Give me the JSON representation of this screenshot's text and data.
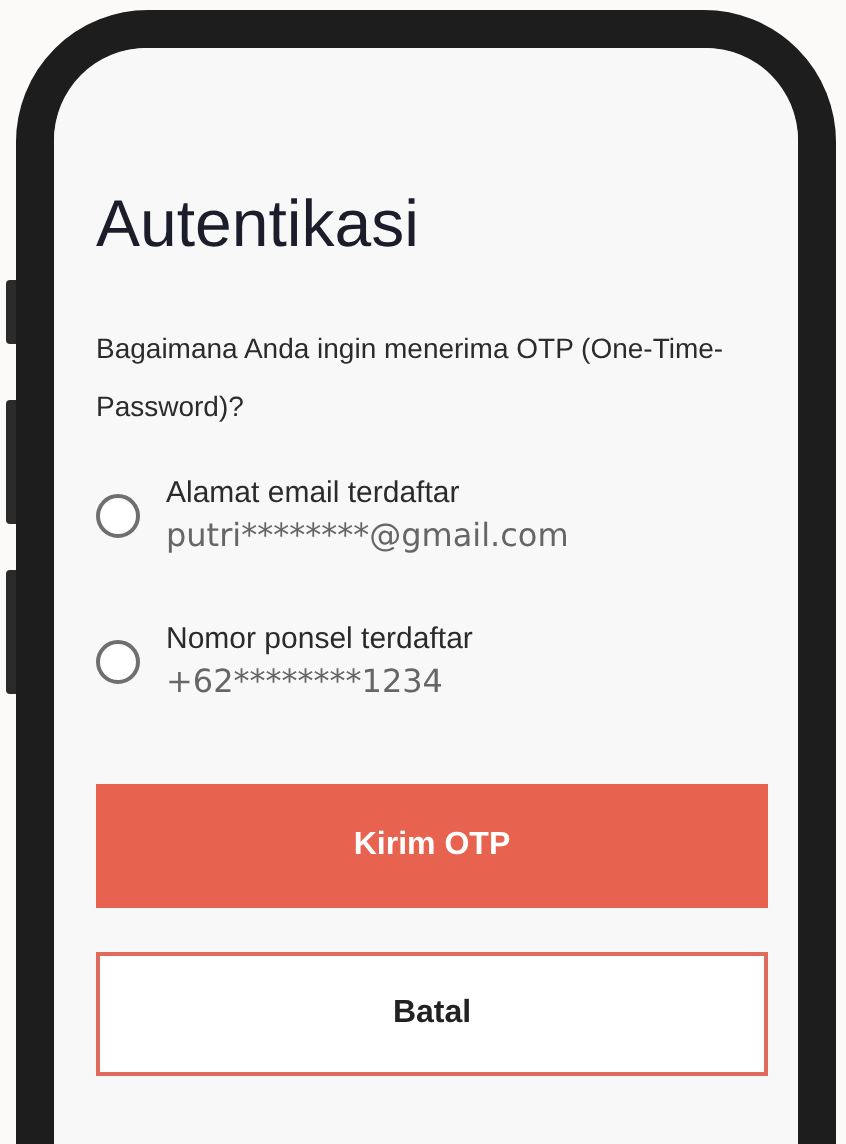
{
  "screen": {
    "title": "Autentikasi",
    "question": "Bagaimana Anda ingin menerima OTP (One-Time-Password)?",
    "options": [
      {
        "label": "Alamat email terdaftar",
        "value": "putri********@gmail.com",
        "selected": false
      },
      {
        "label": "Nomor ponsel terdaftar",
        "value": "+62********1234",
        "selected": false
      }
    ],
    "buttons": [
      {
        "kind": "primary",
        "label": "Kirim OTP"
      },
      {
        "kind": "secondary",
        "label": "Batal"
      }
    ]
  }
}
